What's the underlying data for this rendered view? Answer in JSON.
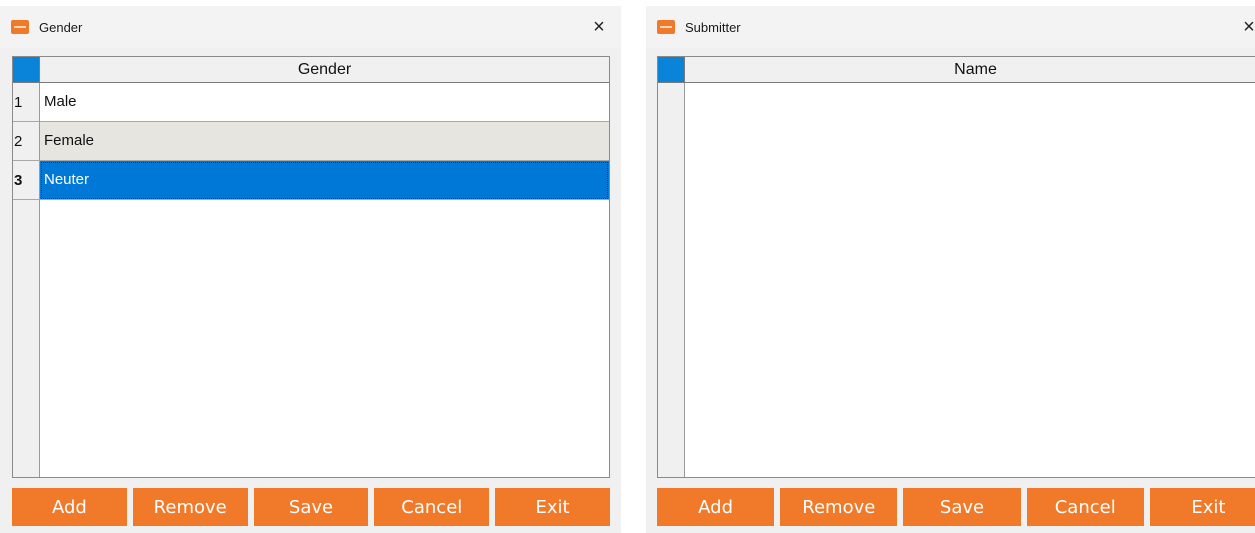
{
  "windows": [
    {
      "title": "Gender",
      "close_glyph": "×",
      "column_header": "Gender",
      "rows": [
        {
          "num": "1",
          "value": "Male",
          "state": "normal"
        },
        {
          "num": "2",
          "value": "Female",
          "state": "alt"
        },
        {
          "num": "3",
          "value": "Neuter",
          "state": "selected"
        }
      ],
      "buttons": {
        "add": "Add",
        "remove": "Remove",
        "save": "Save",
        "cancel": "Cancel",
        "exit": "Exit"
      }
    },
    {
      "title": "Submitter",
      "close_glyph": "×",
      "column_header": "Name",
      "rows": [],
      "buttons": {
        "add": "Add",
        "remove": "Remove",
        "save": "Save",
        "cancel": "Cancel",
        "exit": "Exit"
      }
    }
  ],
  "colors": {
    "accent_orange": "#f07a2a",
    "selection_blue": "#0078d7",
    "corner_blue": "#0a84d8",
    "alt_row": "#e7e5e0"
  },
  "icons": {
    "app": "app-logo-icon",
    "close": "close-icon"
  }
}
